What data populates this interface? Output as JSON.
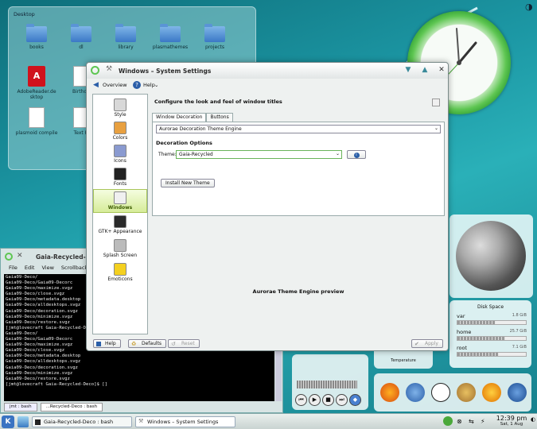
{
  "desktop": {
    "folder_title": "Desktop",
    "items": [
      {
        "label": "books",
        "kind": "folder"
      },
      {
        "label": "dl",
        "kind": "folder"
      },
      {
        "label": "library",
        "kind": "folder"
      },
      {
        "label": "plasmathemes",
        "kind": "folder"
      },
      {
        "label": "projects",
        "kind": "folder"
      },
      {
        "label": "AdobeReader.de sktop",
        "kind": "pdf"
      },
      {
        "label": "Birthda",
        "kind": "doc"
      },
      {
        "label": "plasmoid compile",
        "kind": "doc"
      },
      {
        "label": "Text Fi",
        "kind": "doc"
      }
    ]
  },
  "settings_window": {
    "title": "Windows – System Settings",
    "toolbar": {
      "overview": "Overview",
      "help": "Help"
    },
    "categories": [
      {
        "label": "Style",
        "icon": "style-icon",
        "color": "#d8d8d8"
      },
      {
        "label": "Colors",
        "icon": "colors-icon",
        "color": "#e8a040"
      },
      {
        "label": "Icons",
        "icon": "icons-icon",
        "color": "#8a9ad0"
      },
      {
        "label": "Fonts",
        "icon": "fonts-icon",
        "color": "#222222"
      },
      {
        "label": "Windows",
        "icon": "windows-icon",
        "color": "#f0f0f0",
        "active": true
      },
      {
        "label": "GTK+ Appearance",
        "icon": "gtk-icon",
        "color": "#2a2a2a"
      },
      {
        "label": "Splash Screen",
        "icon": "splash-icon",
        "color": "#bbbbbb"
      },
      {
        "label": "Emoticons",
        "icon": "emoticons-icon",
        "color": "#f4d020"
      }
    ],
    "heading": "Configure the look and feel of window titles",
    "tabs": [
      {
        "label": "Window Decoration",
        "selected": true
      },
      {
        "label": "Buttons",
        "selected": false
      }
    ],
    "engine_value": "Aurorae Decoration Theme Engine",
    "decoration_options": "Decoration Options",
    "theme_label": "Theme:",
    "theme_value": "Gaia-Recycled",
    "install_button": "Install New Theme",
    "preview_label": "Aurorae Theme Engine preview",
    "buttons": {
      "help": "Help",
      "defaults": "Defaults",
      "reset": "Reset",
      "apply": "Apply"
    }
  },
  "terminal": {
    "title": "Gaia-Recycled-Deco",
    "menu": [
      "File",
      "Edit",
      "View",
      "Scrollback",
      "Bo"
    ],
    "lines": [
      "Gaia09-Deco/",
      "Gaia09-Deco/Gaia09-Decorc",
      "Gaia09-Deco/maximize.svgz",
      "Gaia09-Deco/close.svgz",
      "Gaia09-Deco/metadata.desktop",
      "Gaia09-Deco/alldesktops.svgz",
      "Gaia09-Deco/decoration.svgz",
      "Gaia09-Deco/minimize.svgz",
      "Gaia09-Deco/restore.svgz",
      "[jmt@lovecraft Gaia-Recycled-Deco",
      "Gaia09-Deco/",
      "Gaia09-Deco/Gaia09-Decorc",
      "Gaia09-Deco/maximize.svgz",
      "Gaia09-Deco/close.svgz",
      "Gaia09-Deco/metadata.desktop",
      "Gaia09-Deco/alldesktops.svgz",
      "Gaia09-Deco/decoration.svgz",
      "Gaia09-Deco/minimize.svgz",
      "Gaia09-Deco/restore.svgz",
      "[jmt@lovecraft Gaia-Recycled-Deco]$ []"
    ],
    "tabs": [
      "jmt : bash",
      "...Recycled-Deco : bash"
    ]
  },
  "widgets": {
    "disk": {
      "title": "Disk Space",
      "rows": [
        {
          "name": "var",
          "size": "1.8 GiB",
          "used": 0.55
        },
        {
          "name": "home",
          "size": "25.7 GiB",
          "used": 0.7
        },
        {
          "name": "root",
          "size": "7.1 GiB",
          "used": 0.6
        }
      ]
    },
    "temperature_label": "Temperature",
    "media_buttons": [
      "prev",
      "play",
      "stop",
      "next"
    ]
  },
  "taskbar": {
    "k_label": "K",
    "tasks": [
      "Gaia-Recycled-Deco : bash",
      "Windows – System Settings"
    ],
    "time": "12:39 pm",
    "date": "Sat, 1 Aug"
  },
  "colors": {
    "accent_green": "#5ec652",
    "active_category": "#d6ec99"
  }
}
